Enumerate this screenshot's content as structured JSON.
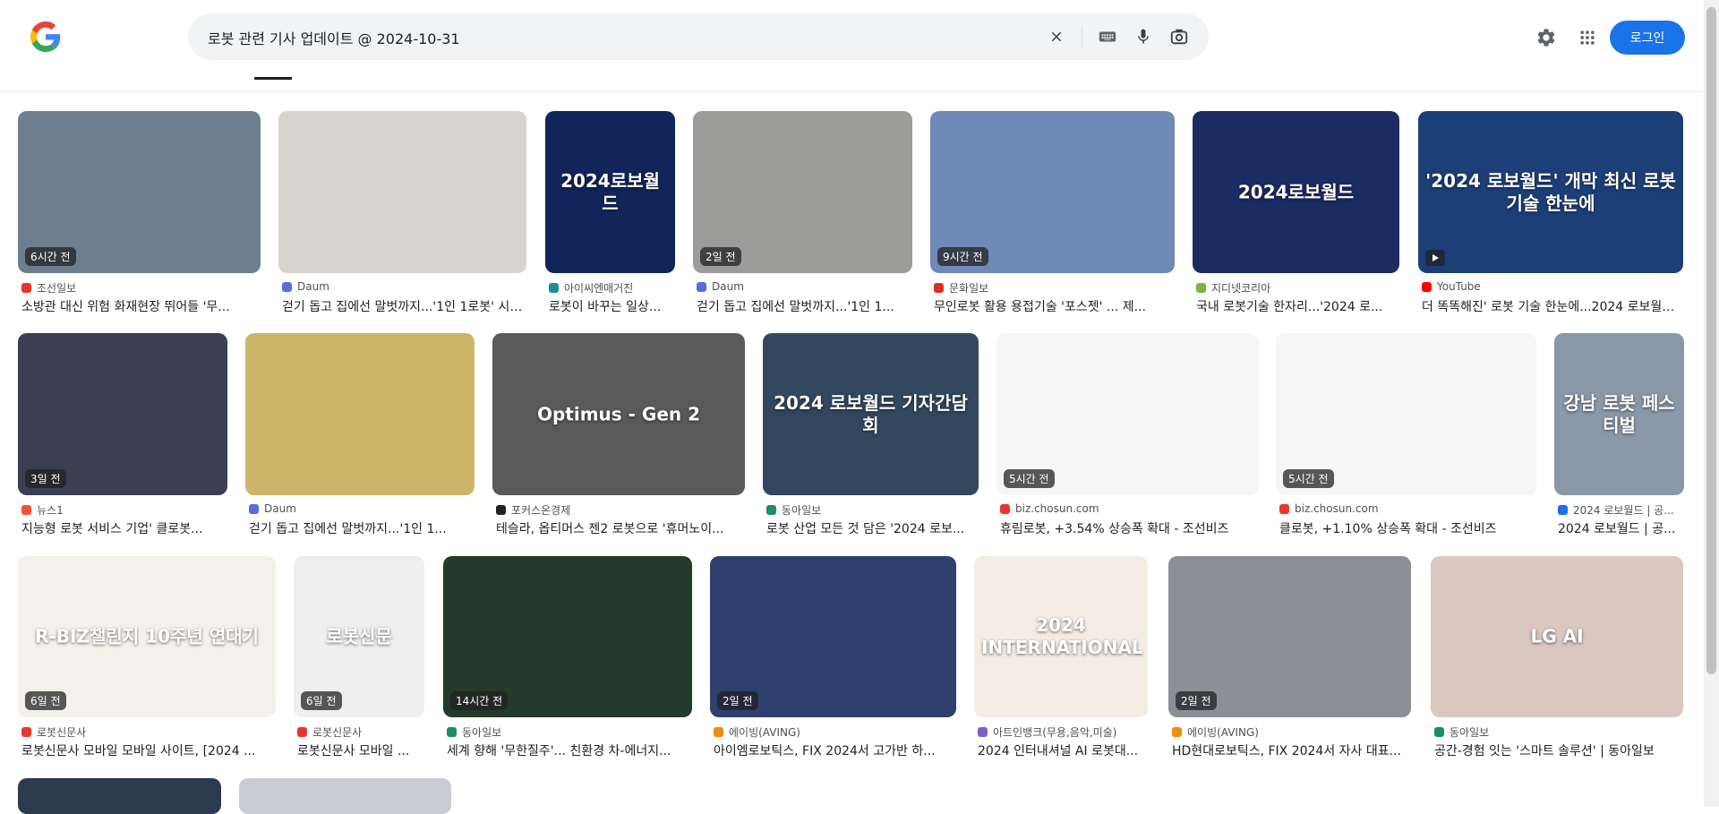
{
  "search": {
    "query": "로봇 관련 기사 업데이트 @ 2024-10-31"
  },
  "header": {
    "login_label": "로그인"
  },
  "results": [
    {
      "src": "조선일보",
      "title": "소방관 대신 위험 화재현장 뛰어들 '무...",
      "badge": "6시간 전",
      "fav": "#e8362c",
      "bg": "#6d7f8e",
      "thumb_text": "",
      "video": false
    },
    {
      "src": "Daum",
      "title": "걷기 돕고 집에선 말벗까지...'1인 1로봇' 시대...",
      "badge": "",
      "fav": "#5b6bdf",
      "bg": "#d7d4cf",
      "thumb_text": "",
      "video": false
    },
    {
      "src": "아이씨엔매거진",
      "title": "로봇이 바꾸는 일상...",
      "badge": "",
      "fav": "#1a8f8f",
      "bg": "#12255a",
      "thumb_text": "2024로보월드",
      "video": false
    },
    {
      "src": "Daum",
      "title": "걷기 돕고 집에선 말벗까지...'1인 1...",
      "badge": "2일 전",
      "fav": "#5b6bdf",
      "bg": "#9c9c9a",
      "thumb_text": "",
      "video": false
    },
    {
      "src": "문화일보",
      "title": "무인로봇 활용 용접기술 '포스젯' ... 제...",
      "badge": "9시간 전",
      "fav": "#d93025",
      "bg": "#6f89b8",
      "thumb_text": "",
      "video": false
    },
    {
      "src": "지디넷코리아",
      "title": "국내 로봇기술 한자리...'2024 로...",
      "badge": "",
      "fav": "#7cb342",
      "bg": "#1d2b63",
      "thumb_text": "2024로보월드",
      "video": false
    },
    {
      "src": "YouTube",
      "title": "더 똑똑해진' 로봇 기술 한눈에...2024 로보월드...",
      "badge": "",
      "fav": "#ff0000",
      "bg": "#1d3f78",
      "thumb_text": "'2024 로보월드' 개막 최신 로봇 기술 한눈에",
      "video": true
    },
    {
      "src": "뉴스1",
      "title": "지능형 로봇 서비스 기업' 클로봇...",
      "badge": "3일 전",
      "fav": "#f2542d",
      "bg": "#3a3f52",
      "thumb_text": "",
      "video": false
    },
    {
      "src": "Daum",
      "title": "걷기 돕고 집에선 말벗까지...'1인 1...",
      "badge": "",
      "fav": "#5b6bdf",
      "bg": "#cdb56a",
      "thumb_text": "",
      "video": false
    },
    {
      "src": "포커스온경제",
      "title": "테슬라, 옵티머스 젠2 로봇으로 '휴머노이...",
      "badge": "",
      "fav": "#222222",
      "bg": "#5a5a5a",
      "thumb_text": "Optimus - Gen 2",
      "video": false
    },
    {
      "src": "동아일보",
      "title": "로봇 산업 모든 것 담은 '2024 로보...",
      "badge": "",
      "fav": "#1a8f6b",
      "bg": "#33475f",
      "thumb_text": "2024 로보월드 기자간담회",
      "video": false
    },
    {
      "src": "biz.chosun.com",
      "title": "휴림로봇, +3.54% 상승폭 확대 - 조선비즈",
      "badge": "5시간 전",
      "fav": "#e8362c",
      "bg": "#f6f6f6",
      "thumb_text": "",
      "video": false
    },
    {
      "src": "biz.chosun.com",
      "title": "클로봇, +1.10% 상승폭 확대 - 조선비즈",
      "badge": "5시간 전",
      "fav": "#e8362c",
      "bg": "#f6f6f6",
      "thumb_text": "",
      "video": false
    },
    {
      "src": "2024 로보월드 | 공...",
      "title": "2024 로보월드 | 공...",
      "badge": "",
      "fav": "#1a73e8",
      "bg": "#8a98a8",
      "thumb_text": "강남 로봇 페스티벌",
      "video": false
    },
    {
      "src": "로봇신문사",
      "title": "로봇신문사 모바일 모바일 사이트, [2024 ...",
      "badge": "6일 전",
      "fav": "#e8362c",
      "bg": "#f4f1ea",
      "thumb_text": "R-BIZ챌린지 10주년 연대기",
      "video": false
    },
    {
      "src": "로봇신문사",
      "title": "로봇신문사 모바일 ...",
      "badge": "6일 전",
      "fav": "#e8362c",
      "bg": "#efefef",
      "thumb_text": "로봇신문",
      "video": false
    },
    {
      "src": "동아일보",
      "title": "세계 향해 '무한질주'... 친환경 차-에너지...",
      "badge": "14시간 전",
      "fav": "#1a8f6b",
      "bg": "#243a2a",
      "thumb_text": "",
      "video": false
    },
    {
      "src": "에이빙(AVING)",
      "title": "아이엠로보틱스, FIX 2024서 고가반 하...",
      "badge": "2일 전",
      "fav": "#f08c00",
      "bg": "#2f3f6e",
      "thumb_text": "",
      "video": false
    },
    {
      "src": "아트인뱅크(무용,음악,미술)",
      "title": "2024 인터내셔널 AI 로봇대...",
      "badge": "",
      "fav": "#7b61c4",
      "bg": "#f3ede4",
      "thumb_text": "2024 INTERNATIONAL",
      "video": false
    },
    {
      "src": "에이빙(AVING)",
      "title": "HD현대로보틱스, FIX 2024서 자사 대표...",
      "badge": "2일 전",
      "fav": "#f08c00",
      "bg": "#8b8f96",
      "thumb_text": "",
      "video": false
    },
    {
      "src": "동아일보",
      "title": "공간-경험 잇는 '스마트 솔루션' | 동아일보",
      "badge": "",
      "fav": "#1a8f6b",
      "bg": "#d9c7c0",
      "thumb_text": "LG AI",
      "video": false
    }
  ]
}
